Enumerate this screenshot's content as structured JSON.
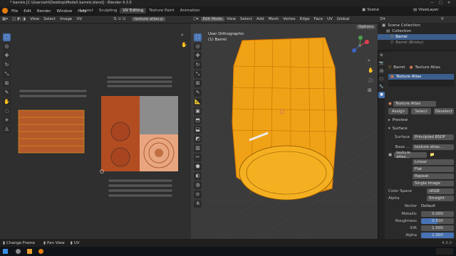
{
  "window": {
    "title": "* barrels [C:\\Users\\ehl\\Desktop\\Model\\ barrels.blend] - Blender 4.3.0"
  },
  "menu": [
    "File",
    "Edit",
    "Render",
    "Window",
    "Help"
  ],
  "workspaces": [
    "Layout",
    "Sculpting",
    "UV Editing",
    "Texture Paint",
    "Animation"
  ],
  "active_workspace": "UV Editing",
  "scene": {
    "label": "Scene",
    "viewlayer": "ViewLayer"
  },
  "uv_editor": {
    "menus": [
      "View",
      "Select",
      "Image",
      "UV"
    ],
    "image_name": "texture atlas.p"
  },
  "viewport": {
    "mode": "Edit Mode",
    "menus": [
      "View",
      "Select",
      "Add",
      "Mesh",
      "Vertex",
      "Edge",
      "Face",
      "UV"
    ],
    "orientation": "Global",
    "options": "Options",
    "view_name": "User Orthographic",
    "object_name": "(1) Barrel"
  },
  "outliner": {
    "root": "Scene Collection",
    "collection": "Collection",
    "items": [
      "Barrel",
      "Barrel (Brisky)"
    ]
  },
  "properties": {
    "object": "Barrel",
    "material_tab": "Texture Atlas",
    "slot": "Texture Atlas",
    "material_name": "Texture Atlas",
    "assign": "Assign",
    "select": "Select",
    "deselect": "Deselect",
    "preview": "Preview",
    "surface_header": "Surface",
    "surface_label": "Surface",
    "surface_value": "Principled BSDF",
    "base_label": "Base ...",
    "base_value": "texture atlas...",
    "image_name": "texture atlas...",
    "interp": "Linear",
    "proj": "Flat",
    "ext": "Repeat",
    "source": "Single Image",
    "colorspace_label": "Color Space",
    "colorspace_value": "sRGB",
    "alpha_label": "Alpha",
    "alpha_value": "Straight",
    "vector_label": "Vector",
    "vector_value": "Default",
    "metallic_label": "Metallic",
    "metallic_value": "0.000",
    "roughness_label": "Roughness",
    "roughness_value": "0.500",
    "ior_label": "IOR",
    "ior_value": "1.500",
    "alpha2_label": "Alpha",
    "alpha2_value": "1.000"
  },
  "status": {
    "left": "Change Frame",
    "middle": "Pan View",
    "right": "UV",
    "version": "4.3.0"
  }
}
